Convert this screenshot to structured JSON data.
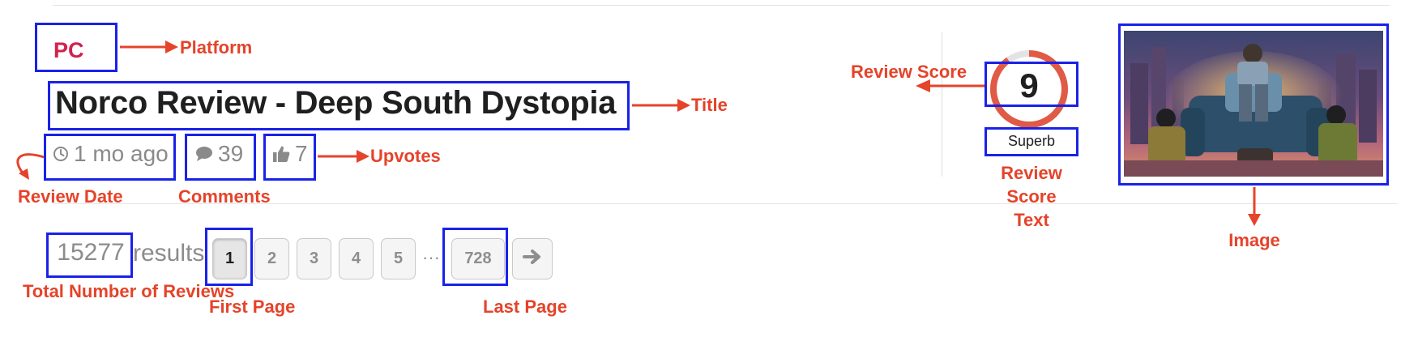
{
  "review": {
    "platform": "PC",
    "title": "Norco Review - Deep South Dystopia",
    "date": "1 mo ago",
    "comments": "39",
    "upvotes": "7",
    "score": "9",
    "score_text": "Superb",
    "score_fraction": 0.9,
    "image_alt": "Norco cover art"
  },
  "pagination": {
    "total": "15277",
    "results_label": "results",
    "pages": [
      "1",
      "2",
      "3",
      "4",
      "5"
    ],
    "ellipsis": "···",
    "last_page": "728",
    "next_icon": "arrow-right-icon"
  },
  "annotations": {
    "platform": "Platform",
    "title": "Title",
    "upvotes": "Upvotes",
    "review_date": "Review Date",
    "comments": "Comments",
    "review_score": "Review Score",
    "review_score_text": "Review Score Text",
    "image": "Image",
    "total_reviews": "Total Number of Reviews",
    "first_page": "First Page",
    "last_page": "Last Page"
  },
  "colors": {
    "annotation_box": "#1a22e6",
    "annotation_text": "#e5432a",
    "platform": "#d4204d",
    "score_ring": "#e05a45"
  }
}
